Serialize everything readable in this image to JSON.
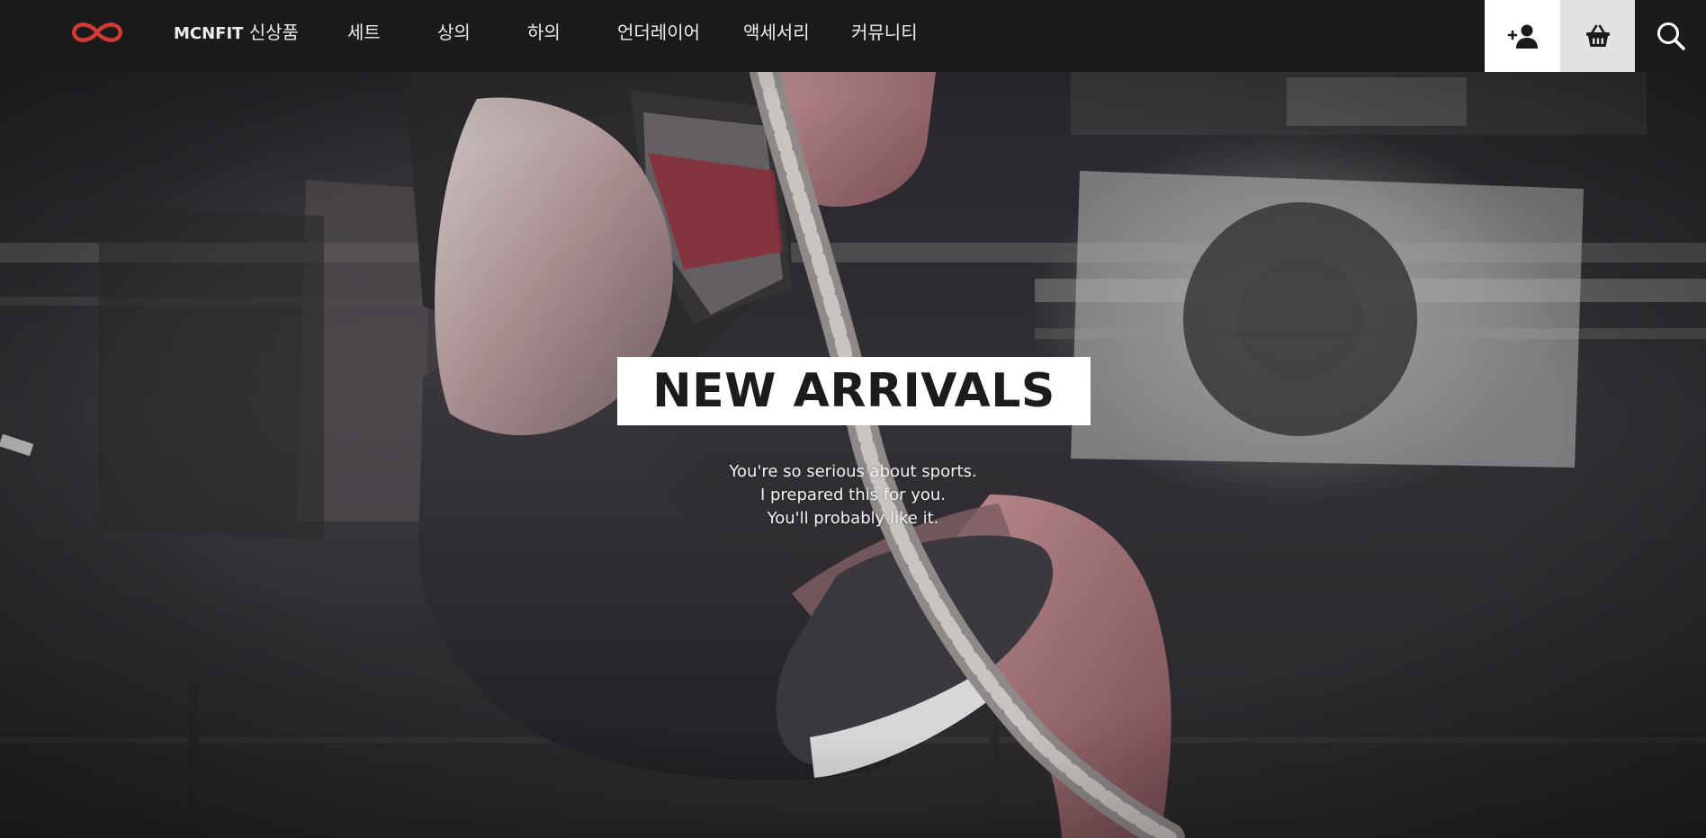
{
  "nav": {
    "brand_main": "MCNFIT",
    "brand_sub": "신상품",
    "items": [
      "세트",
      "상의",
      "하의",
      "언더레이어",
      "액세서리",
      "커뮤니티"
    ]
  },
  "icons": {
    "logo": "infinity-logo",
    "signup": "user-plus-icon",
    "basket": "basket-icon",
    "search": "search-icon"
  },
  "hero": {
    "title": "NEW ARRIVALS",
    "lines": [
      "You're so serious about sports.",
      "I prepared this for you.",
      "You'll probably like it."
    ]
  },
  "colors": {
    "navbar": "#1b1b1c",
    "logo": "#d23a34",
    "nav_text": "#ececec"
  }
}
